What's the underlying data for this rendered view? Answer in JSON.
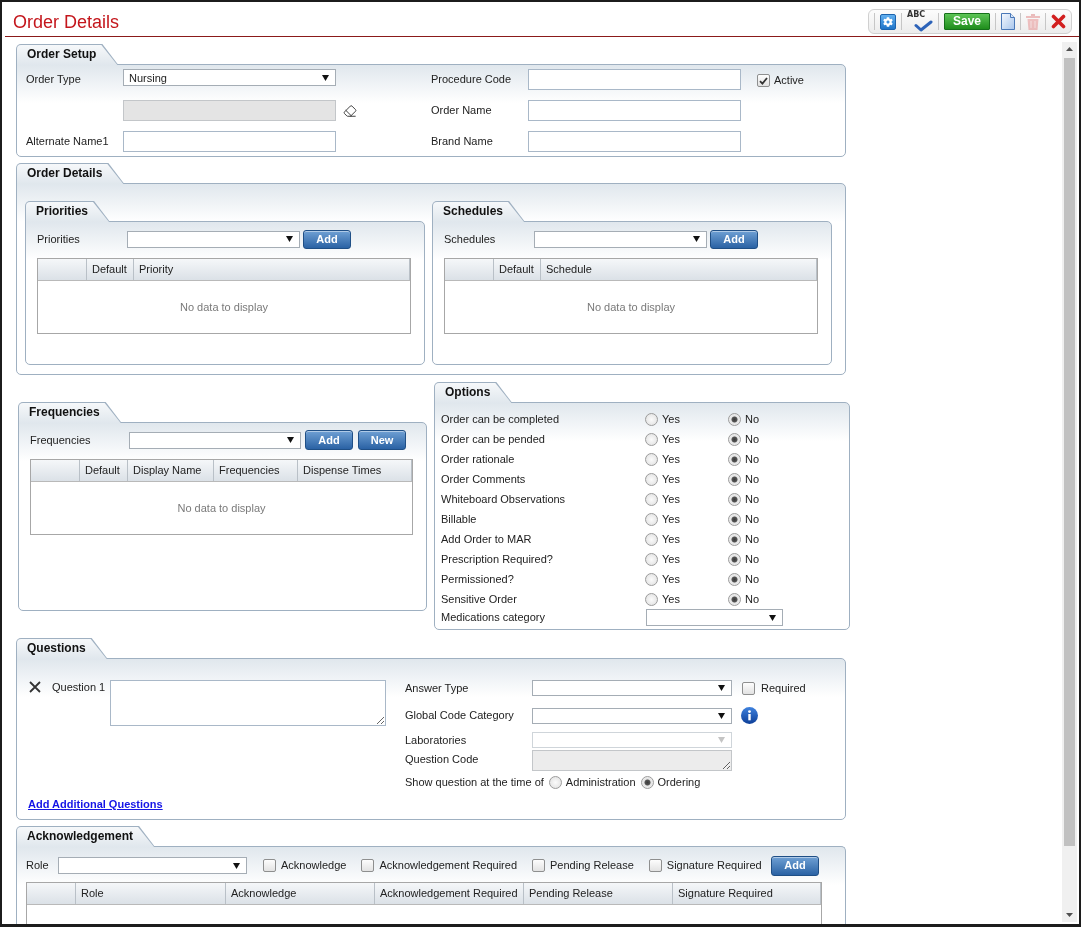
{
  "window": {
    "title": "Order Details"
  },
  "toolbar": [
    {
      "kind": "settings",
      "disabled": false
    },
    {
      "kind": "spell_check",
      "text": "ABC",
      "disabled": false
    },
    {
      "kind": "save",
      "label": "Save",
      "disabled": false
    },
    {
      "kind": "document",
      "disabled": false
    },
    {
      "kind": "delete",
      "disabled": true
    },
    {
      "kind": "close",
      "disabled": false
    }
  ],
  "order_setup": {
    "title": "Order Setup",
    "order_type": {
      "label": "Order Type",
      "value": "Nursing"
    },
    "field_2": {
      "disabled": true
    },
    "alternate_name": {
      "label": "Alternate Name1"
    },
    "procedure_code": {
      "label": "Procedure Code"
    },
    "order_name": {
      "label": "Order Name"
    },
    "brand_name": {
      "label": "Brand Name"
    },
    "active": {
      "label": "Active",
      "checked": true
    }
  },
  "order_details": {
    "title": "Order Details",
    "panels": [
      {
        "title": "Priorities",
        "label": "Priorities",
        "button": "Add",
        "columns": [
          "Default",
          "Priority"
        ],
        "empty_text": "No data to display"
      },
      {
        "title": "Schedules",
        "label": "Schedules",
        "button": "Add",
        "columns": [
          "Default",
          "Schedule"
        ],
        "empty_text": "No data to display"
      }
    ]
  },
  "frequencies": {
    "title": "Frequencies",
    "label": "Frequencies",
    "buttons": [
      "Add",
      "New"
    ],
    "columns": [
      "Default",
      "Display Name",
      "Frequencies",
      "Dispense Times"
    ],
    "empty_text": "No data to display"
  },
  "options": {
    "title": "Options",
    "rows": [
      {
        "label": "Order can be completed",
        "choices": [
          {
            "label": "Yes",
            "selected": false
          },
          {
            "label": "No",
            "selected": true
          }
        ]
      },
      {
        "label": "Order can be pended",
        "choices": [
          {
            "label": "Yes",
            "selected": false
          },
          {
            "label": "No",
            "selected": true
          }
        ]
      },
      {
        "label": "Order rationale",
        "choices": [
          {
            "label": "Yes",
            "selected": false
          },
          {
            "label": "No",
            "selected": true
          }
        ]
      },
      {
        "label": "Order Comments",
        "choices": [
          {
            "label": "Yes",
            "selected": false
          },
          {
            "label": "No",
            "selected": true
          }
        ]
      },
      {
        "label": "Whiteboard Observations",
        "choices": [
          {
            "label": "Yes",
            "selected": false
          },
          {
            "label": "No",
            "selected": true
          }
        ]
      },
      {
        "label": "Billable",
        "choices": [
          {
            "label": "Yes",
            "selected": false
          },
          {
            "label": "No",
            "selected": true
          }
        ]
      },
      {
        "label": "Add Order to MAR",
        "choices": [
          {
            "label": "Yes",
            "selected": false
          },
          {
            "label": "No",
            "selected": true
          }
        ]
      },
      {
        "label": "Prescription Required?",
        "choices": [
          {
            "label": "Yes",
            "selected": false
          },
          {
            "label": "No",
            "selected": true
          }
        ]
      },
      {
        "label": "Permissioned?",
        "choices": [
          {
            "label": "Yes",
            "selected": false
          },
          {
            "label": "No",
            "selected": true
          }
        ]
      },
      {
        "label": "Sensitive Order",
        "choices": [
          {
            "label": "Yes",
            "selected": false
          },
          {
            "label": "No",
            "selected": true
          }
        ]
      }
    ],
    "medications_category": {
      "label": "Medications category"
    }
  },
  "questions": {
    "title": "Questions",
    "items": [
      {
        "label": "Question 1"
      }
    ],
    "answer_type": {
      "label": "Answer Type"
    },
    "required": {
      "label": "Required",
      "checked": false
    },
    "global_code_category": {
      "label": "Global Code Category"
    },
    "laboratories": {
      "label": "Laboratories",
      "disabled": true
    },
    "question_code": {
      "label": "Question Code",
      "disabled": true
    },
    "show_at": {
      "label": "Show question at the time of",
      "choices": [
        {
          "label": "Administration",
          "selected": false
        },
        {
          "label": "Ordering",
          "selected": true
        }
      ]
    },
    "add_link": "Add Additional Questions"
  },
  "acknowledgement": {
    "title": "Acknowledgement",
    "role": {
      "label": "Role"
    },
    "checkboxes": [
      {
        "label": "Acknowledge",
        "checked": false
      },
      {
        "label": "Acknowledgement Required",
        "checked": false
      },
      {
        "label": "Pending Release",
        "checked": false
      },
      {
        "label": "Signature Required",
        "checked": false
      }
    ],
    "button": "Add",
    "columns": [
      "Role",
      "Acknowledge",
      "Acknowledgement Required",
      "Pending Release",
      "Signature Required"
    ]
  }
}
